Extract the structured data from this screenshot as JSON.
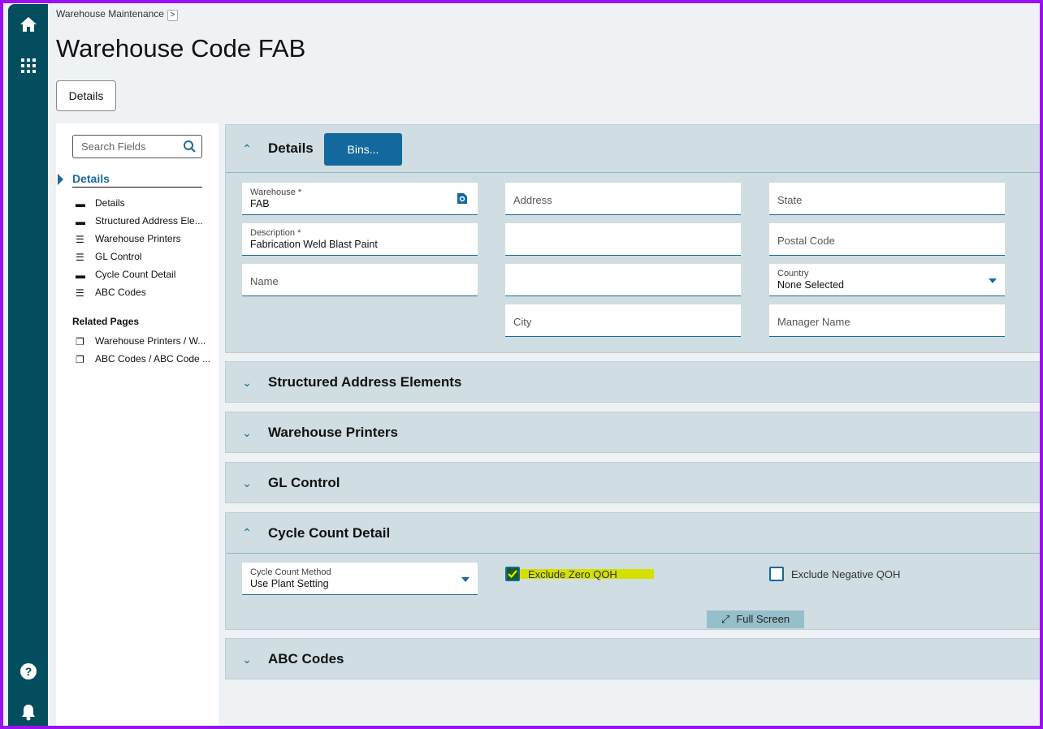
{
  "breadcrumb": {
    "label": "Warehouse Maintenance"
  },
  "page_title": "Warehouse Code FAB",
  "tab_details": "Details",
  "left_panel": {
    "search_placeholder": "Search Fields",
    "section": "Details",
    "items": [
      {
        "label": "Details",
        "icon": "card-icon"
      },
      {
        "label": "Structured Address Ele...",
        "icon": "card-icon"
      },
      {
        "label": "Warehouse Printers",
        "icon": "list-icon"
      },
      {
        "label": "GL Control",
        "icon": "list-icon"
      },
      {
        "label": "Cycle Count Detail",
        "icon": "card-icon"
      },
      {
        "label": "ABC Codes",
        "icon": "list-icon"
      }
    ],
    "related_title": "Related Pages",
    "related": [
      {
        "label": "Warehouse Printers / W..."
      },
      {
        "label": "ABC Codes / ABC Code ..."
      }
    ]
  },
  "details": {
    "title": "Details",
    "bins_label": "Bins...",
    "warehouse_label": "Warehouse *",
    "warehouse_value": "FAB",
    "description_label": "Description *",
    "description_value": "Fabrication Weld Blast Paint",
    "name_placeholder": "Name",
    "address_placeholder": "Address",
    "city_placeholder": "City",
    "state_placeholder": "State",
    "postal_placeholder": "Postal Code",
    "country_label": "Country",
    "country_value": "None Selected",
    "manager_placeholder": "Manager Name"
  },
  "sections": {
    "structured": "Structured Address Elements",
    "printers": "Warehouse Printers",
    "gl": "GL Control",
    "cycle": "Cycle Count Detail",
    "abc": "ABC Codes"
  },
  "cycle": {
    "method_label": "Cycle Count Method",
    "method_value": "Use Plant Setting",
    "exclude_zero": "Exclude Zero QOH",
    "exclude_zero_checked": true,
    "exclude_negative": "Exclude Negative QOH",
    "exclude_negative_checked": false,
    "full_screen": "Full Screen"
  },
  "colors": {
    "nav": "#034e5e",
    "accent": "#13699e",
    "panel": "#d0dde2",
    "highlight": "#d4e000"
  }
}
